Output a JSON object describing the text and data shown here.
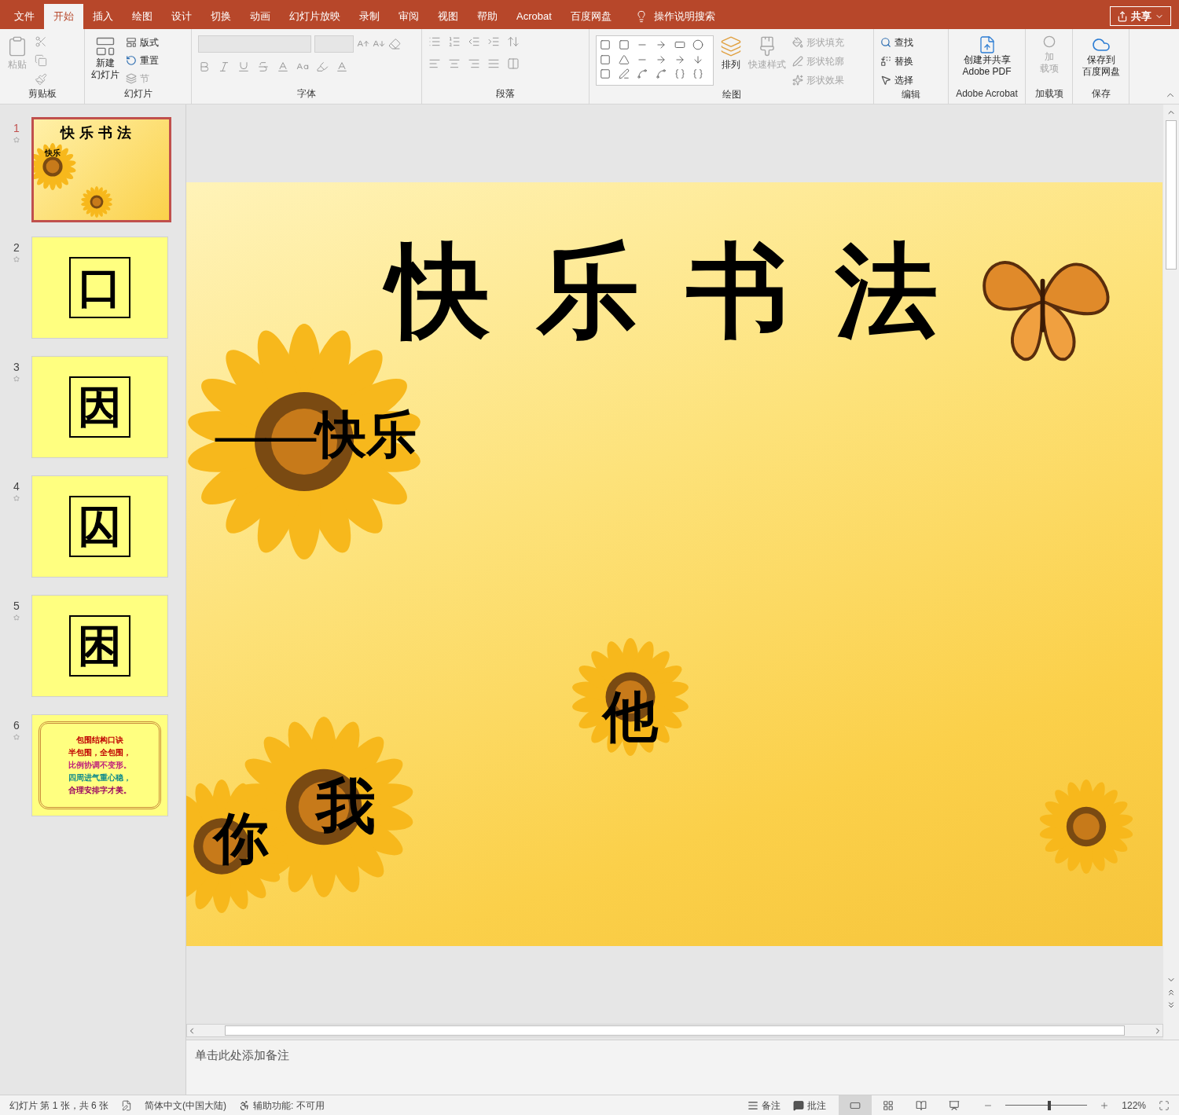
{
  "tabs": [
    {
      "label": "文件",
      "selected": false
    },
    {
      "label": "开始",
      "selected": true
    },
    {
      "label": "插入",
      "selected": false
    },
    {
      "label": "绘图",
      "selected": false
    },
    {
      "label": "设计",
      "selected": false
    },
    {
      "label": "切换",
      "selected": false
    },
    {
      "label": "动画",
      "selected": false
    },
    {
      "label": "幻灯片放映",
      "selected": false
    },
    {
      "label": "录制",
      "selected": false
    },
    {
      "label": "审阅",
      "selected": false
    },
    {
      "label": "视图",
      "selected": false
    },
    {
      "label": "帮助",
      "selected": false
    },
    {
      "label": "Acrobat",
      "selected": false
    },
    {
      "label": "百度网盘",
      "selected": false
    }
  ],
  "search": {
    "placeholder": "操作说明搜索"
  },
  "share_button": "共享",
  "ribbon": {
    "clipboard": {
      "label": "剪贴板",
      "paste": {
        "label": "粘贴",
        "disabled": true
      }
    },
    "slides": {
      "label": "幻灯片",
      "new_slide": [
        "新建",
        "幻灯片"
      ],
      "layout": "版式",
      "reset": "重置",
      "section": {
        "label": "节",
        "disabled": true
      }
    },
    "font": {
      "label": "字体"
    },
    "paragraph": {
      "label": "段落"
    },
    "drawing": {
      "label": "绘图",
      "arrange": "排列",
      "quick_styles": {
        "label": "快速样式",
        "disabled": true
      },
      "shape_options": [
        {
          "label": "形状填充",
          "disabled": true
        },
        {
          "label": "形状轮廓",
          "disabled": true
        },
        {
          "label": "形状效果",
          "disabled": true
        }
      ]
    },
    "editing": {
      "label": "编辑",
      "items": [
        "查找",
        "替换",
        "选择"
      ]
    },
    "acrobat": {
      "label": "Adobe Acrobat",
      "button": [
        "创建并共享",
        "Adobe PDF"
      ]
    },
    "addins": {
      "label": "加载项",
      "button": {
        "lines": [
          "加",
          "载项"
        ],
        "disabled": true
      }
    },
    "save": {
      "label": "保存",
      "button": [
        "保存到",
        "百度网盘"
      ]
    }
  },
  "thumbnails": [
    {
      "number": "1",
      "selected": true,
      "kind": "title",
      "title": "快乐书法",
      "subtitle": "快乐"
    },
    {
      "number": "2",
      "selected": false,
      "kind": "character",
      "character": "口"
    },
    {
      "number": "3",
      "selected": false,
      "kind": "character",
      "character": "因"
    },
    {
      "number": "4",
      "selected": false,
      "kind": "character",
      "character": "囚"
    },
    {
      "number": "5",
      "selected": false,
      "kind": "character",
      "character": "困"
    },
    {
      "number": "6",
      "selected": false,
      "kind": "poem",
      "lines": [
        "包围结构口诀",
        "半包围，全包围，",
        "比例协调不变形。",
        "四周进气重心稳，",
        "合理安排字才美。"
      ]
    }
  ],
  "slide": {
    "title": "快乐书法",
    "subtitle": "——快乐",
    "characters": [
      "他",
      "我",
      "你"
    ]
  },
  "notes": {
    "placeholder": "单击此处添加备注"
  },
  "status_bar": {
    "slide_info": "幻灯片 第 1 张，共 6 张",
    "language": "简体中文(中国大陆)",
    "accessibility": "辅助功能: 不可用",
    "notes_button": "备注",
    "comments_button": "批注",
    "views": [
      {
        "selected": true
      },
      {
        "selected": false
      },
      {
        "selected": false
      },
      {
        "selected": false
      }
    ],
    "zoom": {
      "level": 0.54,
      "reading": "122%"
    }
  }
}
